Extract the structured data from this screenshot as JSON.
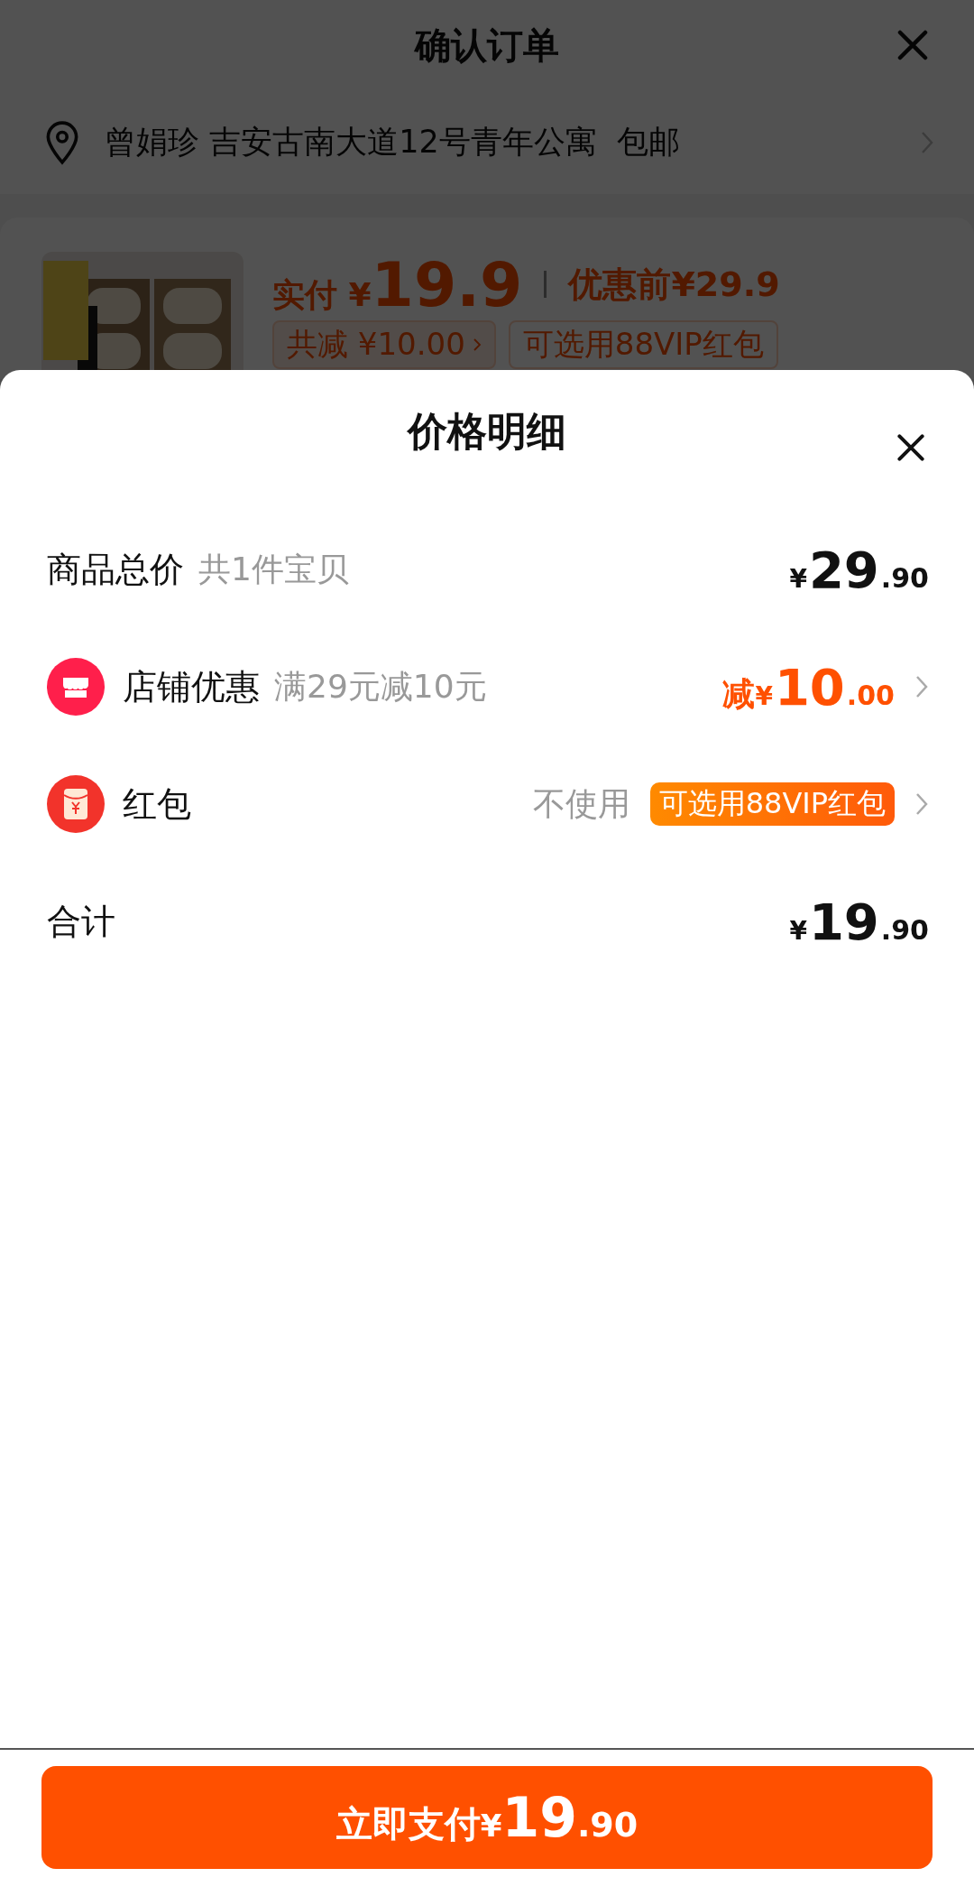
{
  "background_page": {
    "title": "确认订单",
    "address": "曾娟珍 吉安古南大道12号青年公寓",
    "shipping": "包邮",
    "product": {
      "paid_label": "实付",
      "paid_price": {
        "symbol": "¥",
        "amount": "19.9"
      },
      "original_label": "优惠前",
      "original_price": "¥29.9",
      "discount_chip": "共减 ¥10.00",
      "coupon_chip": "可选用88VIP红包"
    }
  },
  "sheet": {
    "title": "价格明细",
    "rows": [
      {
        "kind": "plain",
        "label": "商品总价",
        "note": "共1件宝贝",
        "price": {
          "symbol": "¥",
          "integer": "29",
          "decimal": ".90"
        },
        "highlight": false,
        "chevron": false
      },
      {
        "kind": "store",
        "label": "店铺优惠",
        "note": "满29元减10元",
        "price": {
          "prefix": "减",
          "symbol": "¥",
          "integer": "10",
          "decimal": ".00"
        },
        "highlight": true,
        "chevron": true
      },
      {
        "kind": "red_packet",
        "label": "红包",
        "status": "不使用",
        "badge": "可选用88VIP红包",
        "chevron": true
      },
      {
        "kind": "plain",
        "label": "合计",
        "price": {
          "symbol": "¥",
          "integer": "19",
          "decimal": ".90"
        },
        "highlight": false,
        "chevron": false
      }
    ]
  },
  "pay_button": {
    "label": "立即支付",
    "symbol": "¥",
    "integer": "19",
    "decimal": ".90"
  }
}
